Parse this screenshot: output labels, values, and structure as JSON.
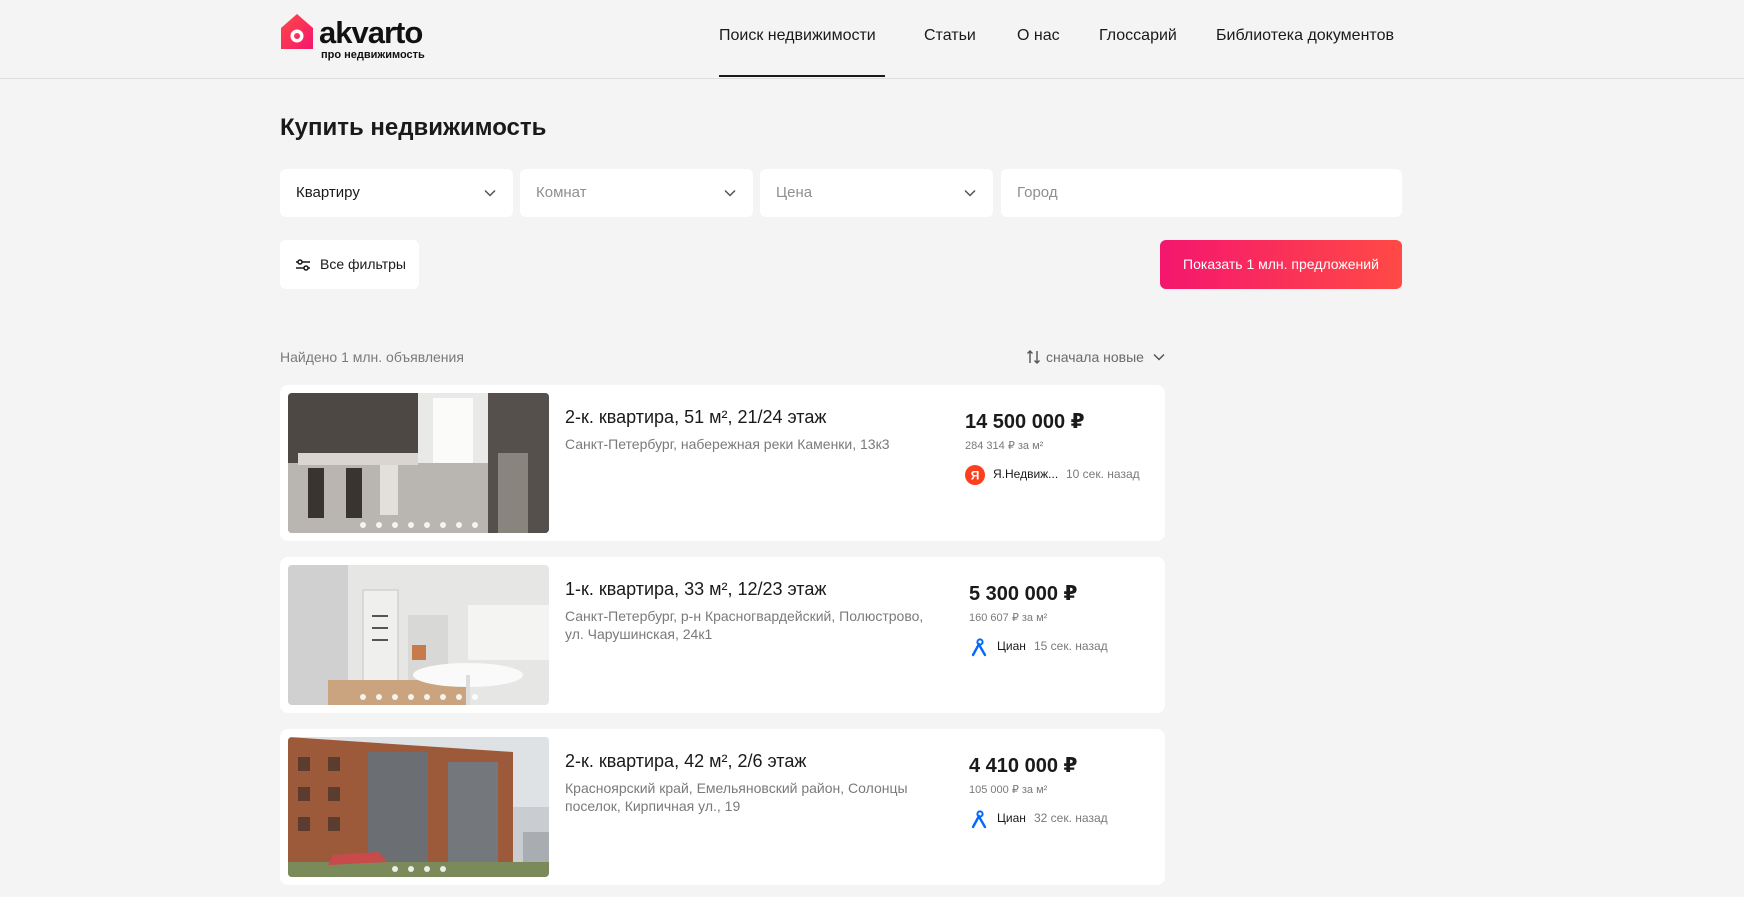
{
  "brand": {
    "logo_text": "akvarto",
    "tagline": "про недвижимость",
    "accent": "#f5166e"
  },
  "nav": [
    {
      "label": "Поиск недвижимости",
      "active": true
    },
    {
      "label": "Статьи",
      "active": false
    },
    {
      "label": "О нас",
      "active": false
    },
    {
      "label": "Глоссарий",
      "active": false
    },
    {
      "label": "Библиотека документов",
      "active": false
    }
  ],
  "page_title": "Купить недвижимость",
  "search": {
    "type": {
      "value": "Квартиру",
      "icon": "chevron-down-icon"
    },
    "rooms": {
      "placeholder": "Комнат",
      "icon": "chevron-down-icon"
    },
    "price": {
      "placeholder": "Цена",
      "icon": "chevron-down-icon"
    },
    "city": {
      "placeholder": "Город"
    }
  },
  "filters_button": {
    "label": "Все фильтры",
    "icon": "sliders-icon"
  },
  "show_button": {
    "label": "Показать 1 млн. предложений"
  },
  "results": {
    "found_text": "Найдено 1 млн. объявления",
    "sort_label": "сначала новые",
    "sort_icon": "sort-arrows-icon"
  },
  "listings": [
    {
      "title": "2-к. квартира, 51 м², 21/24 этаж",
      "address": "Санкт-Петербург, набережная реки Каменки, 13к3",
      "price": "14 500 000 ₽",
      "price_per_m2": "284 314 ₽ за м²",
      "source": "Я.Недвиж...",
      "source_icon": "yandex-icon",
      "time": "10 сек. назад",
      "photo_count": 8
    },
    {
      "title": "1-к. квартира, 33 м², 12/23 этаж",
      "address": "Санкт-Петербург, р-н Красногвардейский, Полюстрово, ул. Чарушинская, 24к1",
      "price": "5 300 000 ₽",
      "price_per_m2": "160 607 ₽ за м²",
      "source": "Циан",
      "source_icon": "cian-icon",
      "time": "15 сек. назад",
      "photo_count": 8
    },
    {
      "title": "2-к. квартира, 42 м², 2/6 этаж",
      "address": "Красноярский край, Емельяновский район, Солонцы поселок, Кирпичная ул., 19",
      "price": "4 410 000 ₽",
      "price_per_m2": "105 000 ₽ за м²",
      "source": "Циан",
      "source_icon": "cian-icon",
      "time": "32 сек. назад",
      "photo_count": 4
    }
  ]
}
